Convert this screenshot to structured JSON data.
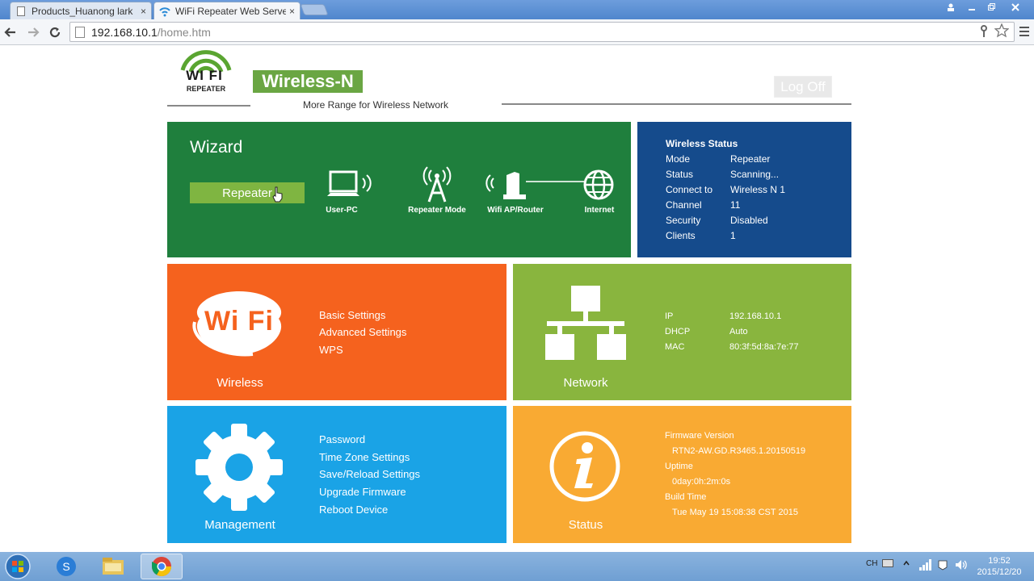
{
  "browser": {
    "tabs": [
      {
        "title": "Products_Huanong lark",
        "close": "×"
      },
      {
        "title": "WiFi Repeater Web Server",
        "close": "×"
      }
    ],
    "address": {
      "host": "192.168.10.1",
      "path": "/home.htm"
    }
  },
  "header": {
    "logo_text": "WI FI",
    "logo_sub": "REPEATER",
    "brand": "Wireless-N",
    "tagline": "More Range for Wireless Network",
    "logoff_label": "Log Off"
  },
  "wizard": {
    "title": "Wizard",
    "button_label": "Repeater",
    "diagram": [
      "User-PC",
      "Repeater Mode",
      "Wifi AP/Router",
      "Internet"
    ]
  },
  "wireless_status": {
    "title": "Wireless Status",
    "rows": [
      {
        "key": "Mode",
        "value": "Repeater"
      },
      {
        "key": "Status",
        "value": "Scanning..."
      },
      {
        "key": "Connect to",
        "value": "Wireless N 1"
      },
      {
        "key": "Channel",
        "value": "11"
      },
      {
        "key": "Security",
        "value": "Disabled"
      },
      {
        "key": "Clients",
        "value": "1"
      }
    ]
  },
  "wireless": {
    "icon_text": "Wi Fi",
    "label": "Wireless",
    "links": [
      "Basic Settings",
      "Advanced Settings",
      "WPS"
    ]
  },
  "network": {
    "label": "Network",
    "rows": [
      {
        "key": "IP",
        "value": "192.168.10.1"
      },
      {
        "key": "DHCP",
        "value": "Auto"
      },
      {
        "key": "MAC",
        "value": "80:3f:5d:8a:7e:77"
      }
    ]
  },
  "management": {
    "label": "Management",
    "links": [
      "Password",
      "Time Zone Settings",
      "Save/Reload Settings",
      "Upgrade Firmware",
      "Reboot Device"
    ]
  },
  "status": {
    "label": "Status",
    "firmware_label": "Firmware Version",
    "firmware_value": "RTN2-AW.GD.R3465.1.20150519",
    "uptime_label": "Uptime",
    "uptime_value": "0day:0h:2m:0s",
    "build_label": "Build Time",
    "build_value": "Tue May 19 15:08:38 CST 2015"
  },
  "taskbar": {
    "tray_lang": "CH",
    "time": "19:52",
    "date": "2015/12/20"
  },
  "colors": {
    "wizard": "#1f7f3d",
    "wireless_status": "#154b8c",
    "wireless": "#f5621e",
    "network": "#89b53e",
    "management": "#1aa3e6",
    "status": "#f9aa33",
    "brand": "#6aa643"
  }
}
